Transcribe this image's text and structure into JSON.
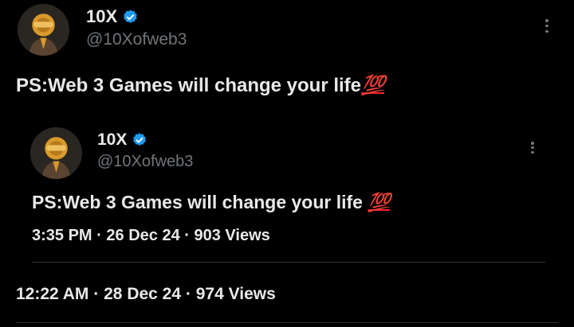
{
  "tweet": {
    "author": {
      "name": "10X",
      "handle": "@10Xofweb3",
      "verified": true
    },
    "text": "PS:Web 3 Games will change your life",
    "emoji": "💯",
    "meta": {
      "time": "12:22 AM",
      "date": "28 Dec 24",
      "views": "974 Views"
    }
  },
  "quoted": {
    "author": {
      "name": "10X",
      "handle": "@10Xofweb3",
      "verified": true
    },
    "text": "PS:Web 3 Games will change your life",
    "emoji": "💯",
    "meta": {
      "time": "3:35 PM",
      "date": "26 Dec 24",
      "views": "903 Views"
    }
  },
  "colors": {
    "verified": "#1d9bf0",
    "emoji": "#f4212e",
    "muted": "#71767b",
    "divider": "#2f3336"
  }
}
